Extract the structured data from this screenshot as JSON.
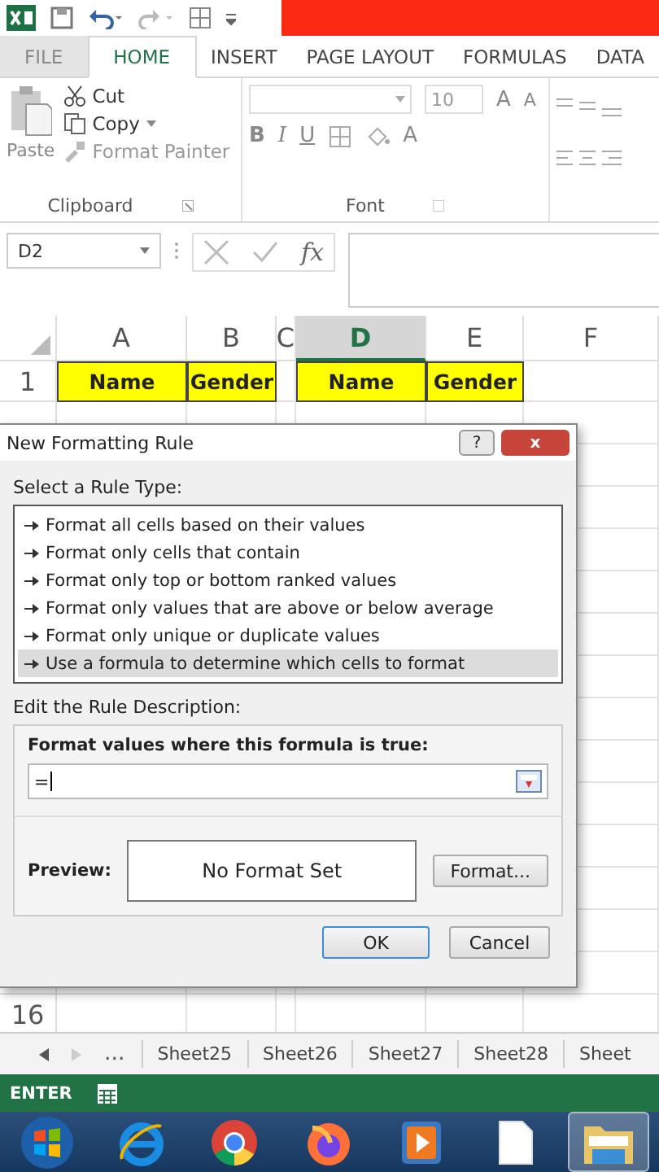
{
  "ribbon": {
    "tabs": [
      {
        "label": "FILE",
        "selected": false,
        "disabled": true
      },
      {
        "label": "HOME",
        "selected": true,
        "disabled": false
      },
      {
        "label": "INSERT",
        "selected": false,
        "disabled": false
      },
      {
        "label": "PAGE LAYOUT",
        "selected": false,
        "disabled": false
      },
      {
        "label": "FORMULAS",
        "selected": false,
        "disabled": false
      },
      {
        "label": "DATA",
        "selected": false,
        "disabled": false
      }
    ],
    "clipboard": {
      "paste": "Paste",
      "cut": "Cut",
      "copy": "Copy",
      "format_painter": "Format Painter",
      "group_label": "Clipboard"
    },
    "font": {
      "size": "10",
      "bold": "B",
      "italic": "I",
      "underline": "U",
      "grow": "A",
      "shrink": "A",
      "font_color": "A",
      "group_label": "Font"
    }
  },
  "formula_bar": {
    "name_box": "D2",
    "fx": "fx"
  },
  "sheet": {
    "columns": [
      {
        "label": "A",
        "selected": false
      },
      {
        "label": "B",
        "selected": false
      },
      {
        "label": "C",
        "selected": false
      },
      {
        "label": "D",
        "selected": true
      },
      {
        "label": "E",
        "selected": false
      },
      {
        "label": "F",
        "selected": false
      }
    ],
    "rows": [
      {
        "number": "1",
        "cells": [
          "Name",
          "Gender",
          "",
          "Name",
          "Gender",
          ""
        ]
      }
    ],
    "lower_rows": [
      {
        "number": "16"
      }
    ]
  },
  "dialog": {
    "title": "New Formatting Rule",
    "help": "?",
    "close": "x",
    "rule_type_label": "Select a Rule Type:",
    "rule_types": [
      {
        "label": "Format all cells based on their values",
        "selected": false
      },
      {
        "label": "Format only cells that contain",
        "selected": false
      },
      {
        "label": "Format only top or bottom ranked values",
        "selected": false
      },
      {
        "label": "Format only values that are above or below average",
        "selected": false
      },
      {
        "label": "Format only unique or duplicate values",
        "selected": false
      },
      {
        "label": "Use a formula to determine which cells to format",
        "selected": true
      }
    ],
    "description_label": "Edit the Rule Description:",
    "formula_label": "Format values where this formula is true:",
    "formula_value": "=",
    "preview_label": "Preview:",
    "preview_text": "No Format Set",
    "format_button": "Format...",
    "ok": "OK",
    "cancel": "Cancel"
  },
  "sheet_tabs": {
    "more": "...",
    "tabs": [
      "Sheet25",
      "Sheet26",
      "Sheet27",
      "Sheet28",
      "Sheet"
    ]
  },
  "status_bar": {
    "mode": "ENTER"
  },
  "taskbar": {
    "items": [
      {
        "kind": "start",
        "selected": false
      },
      {
        "kind": "ie",
        "selected": false
      },
      {
        "kind": "chrome",
        "selected": false
      },
      {
        "kind": "firefox",
        "selected": false
      },
      {
        "kind": "media",
        "selected": false
      },
      {
        "kind": "file",
        "selected": false
      },
      {
        "kind": "folder",
        "selected": true
      }
    ]
  }
}
